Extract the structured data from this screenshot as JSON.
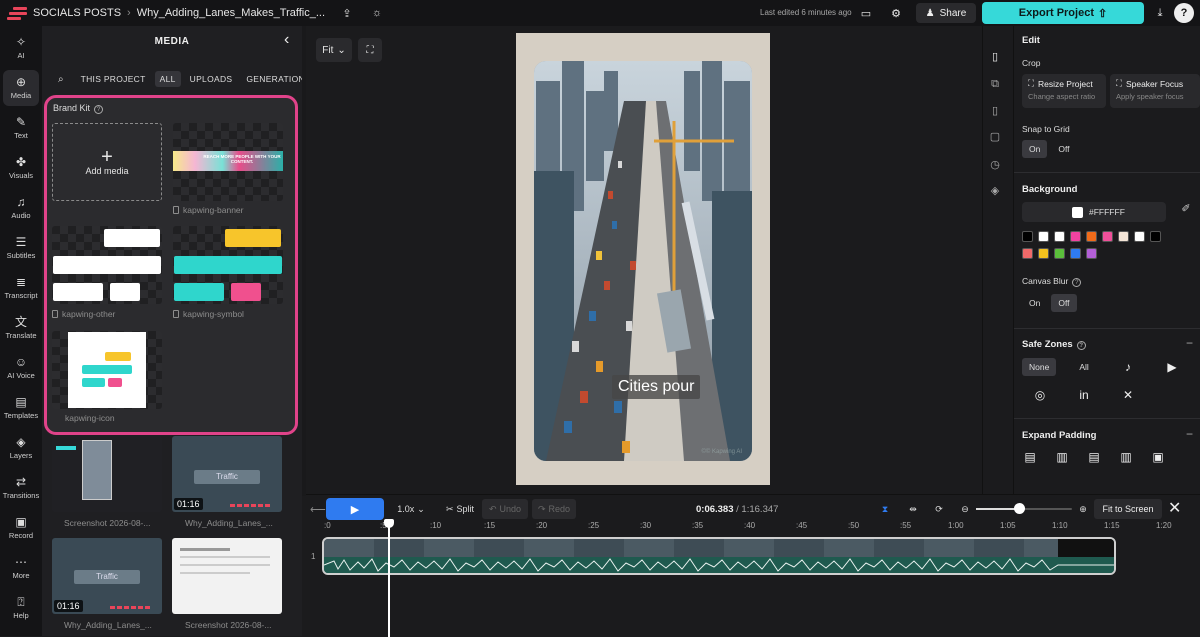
{
  "header": {
    "workspace": "SOCIALS POSTS",
    "project_title": "Why_Adding_Lanes_Makes_Traffic_...",
    "last_edited": "Last edited 6 minutes ago",
    "share_label": "Share",
    "export_label": "Export Project",
    "help_label": "?"
  },
  "leftnav": {
    "items": [
      {
        "label": "AI",
        "icon": "ai-icon"
      },
      {
        "label": "Media",
        "icon": "media-icon"
      },
      {
        "label": "Text",
        "icon": "text-icon"
      },
      {
        "label": "Visuals",
        "icon": "visuals-icon"
      },
      {
        "label": "Audio",
        "icon": "audio-icon"
      },
      {
        "label": "Subtitles",
        "icon": "subtitles-icon"
      },
      {
        "label": "Transcript",
        "icon": "transcript-icon"
      },
      {
        "label": "Translate",
        "icon": "translate-icon"
      },
      {
        "label": "AI Voice",
        "icon": "ai-voice-icon"
      },
      {
        "label": "Templates",
        "icon": "templates-icon"
      },
      {
        "label": "Layers",
        "icon": "layers-icon"
      },
      {
        "label": "Transitions",
        "icon": "transitions-icon"
      },
      {
        "label": "Record",
        "icon": "record-icon"
      },
      {
        "label": "More",
        "icon": "more-icon"
      },
      {
        "label": "Help",
        "icon": "help-icon"
      }
    ]
  },
  "media_panel": {
    "title": "MEDIA",
    "tabs": [
      "THIS PROJECT",
      "ALL",
      "UPLOADS",
      "GENERATIONS"
    ],
    "active_tab": "ALL",
    "brand_kit": {
      "title": "Brand Kit",
      "add_media_label": "Add media",
      "banner_text": "REACH MORE PEOPLE WITH YOUR CONTENT.",
      "items": [
        "kapwing-banner",
        "kapwing-other",
        "kapwing-symbol",
        "kapwing-icon"
      ]
    },
    "recent": [
      {
        "label": "Screenshot 2026-08-...",
        "duration": ""
      },
      {
        "label": "Why_Adding_Lanes_...",
        "duration": "01:16"
      },
      {
        "label": "Why_Adding_Lanes_...",
        "duration": "01:16"
      },
      {
        "label": "Screenshot 2026-08-...",
        "duration": ""
      }
    ]
  },
  "canvas": {
    "fit_label": "Fit",
    "caption": "Cities pour",
    "watermark": "©© Kapwing AI"
  },
  "edit_panel": {
    "title": "Edit",
    "crop_label": "Crop",
    "resize_title": "Resize Project",
    "resize_sub": "Change aspect ratio",
    "speaker_title": "Speaker Focus",
    "speaker_sub": "Apply speaker focus",
    "snap_label": "Snap to Grid",
    "snap_on": "On",
    "snap_off": "Off",
    "background_label": "Background",
    "background_hex": "#FFFFFF",
    "swatches": [
      "#000000",
      "#ffffff",
      "#ffffff",
      "#f043a0",
      "#f06b1a",
      "#f0509a",
      "#f5e6d8",
      "#ffffff",
      "#000000",
      "#f06a6a",
      "#f3c21e",
      "#5bbf3b",
      "#2f7bf0",
      "#b35fd6"
    ],
    "canvas_blur_label": "Canvas Blur",
    "blur_on": "On",
    "blur_off": "Off",
    "safe_zones_label": "Safe Zones",
    "safe_none": "None",
    "safe_all": "All",
    "expand_padding_label": "Expand Padding"
  },
  "timeline": {
    "speed": "1.0x",
    "split": "Split",
    "undo": "Undo",
    "redo": "Redo",
    "current_time": "0:06.383",
    "total_time": "/ 1:16.347",
    "fit_to_screen": "Fit to Screen",
    "track_number": "1",
    "ticks": [
      ":0",
      ":5",
      ":10",
      ":15",
      ":20",
      ":25",
      ":30",
      ":35",
      ":40",
      ":45",
      ":50",
      ":55",
      "1:00",
      "1:05",
      "1:10",
      "1:15",
      "1:20"
    ]
  }
}
